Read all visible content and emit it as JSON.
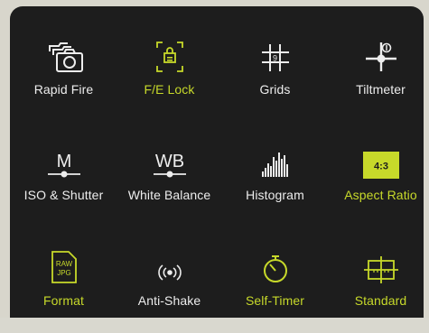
{
  "accent_color": "#c7d92a",
  "text_color": "#ededed",
  "options": [
    {
      "label": "Rapid Fire",
      "icon": "burst-camera-icon",
      "active": false
    },
    {
      "label": "F/E Lock",
      "icon": "focus-exposure-lock-icon",
      "active": true
    },
    {
      "label": "Grids",
      "icon": "grid-icon",
      "active": false,
      "icon_text": "9"
    },
    {
      "label": "Tiltmeter",
      "icon": "tiltmeter-icon",
      "active": false
    },
    {
      "label": "ISO & Shutter",
      "icon": "manual-mode-icon",
      "active": false,
      "icon_text": "M"
    },
    {
      "label": "White Balance",
      "icon": "white-balance-icon",
      "active": false,
      "icon_text": "WB"
    },
    {
      "label": "Histogram",
      "icon": "histogram-icon",
      "active": false
    },
    {
      "label": "Aspect Ratio",
      "icon": "aspect-ratio-icon",
      "active": true,
      "icon_text": "4:3"
    },
    {
      "label": "Format",
      "icon": "file-format-icon",
      "active": true,
      "icon_text": [
        "RAW",
        "JPG"
      ]
    },
    {
      "label": "Anti-Shake",
      "icon": "anti-shake-icon",
      "active": false
    },
    {
      "label": "Self-Timer",
      "icon": "self-timer-icon",
      "active": true
    },
    {
      "label": "Standard",
      "icon": "standard-mode-icon",
      "active": true
    }
  ]
}
